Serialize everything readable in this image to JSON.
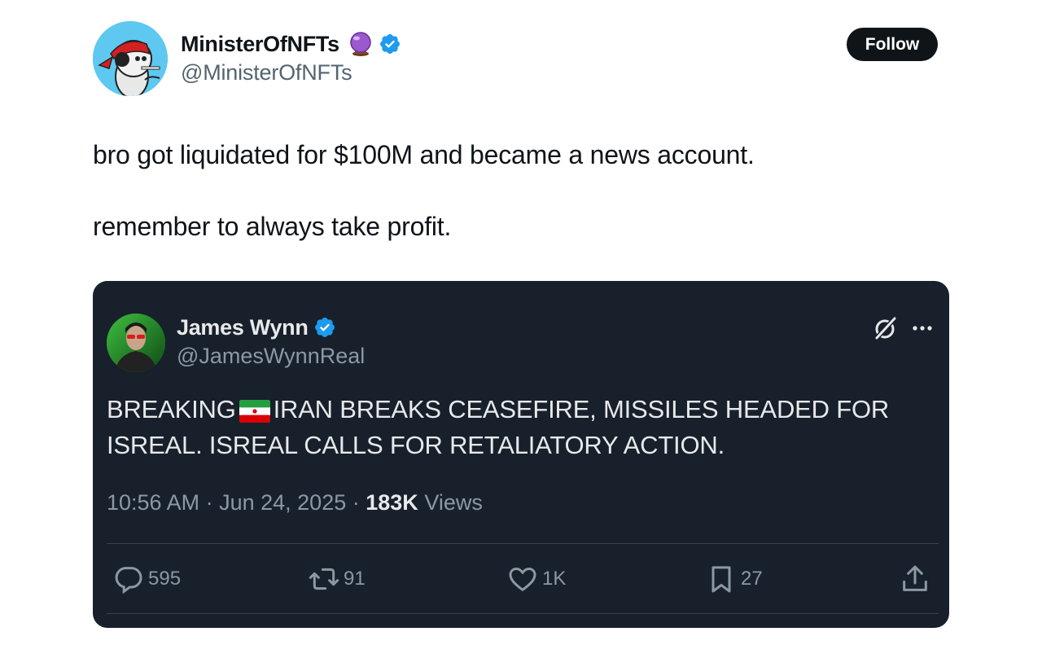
{
  "tweet": {
    "author_name": "MinisterOfNFTs",
    "author_handle": "@MinisterOfNFTs",
    "follow_label": "Follow",
    "text_line1": "bro got liquidated for $100M and became a news account.",
    "text_line2": "remember to always take profit."
  },
  "quoted": {
    "author_name": "James Wynn",
    "author_handle": "@JamesWynnReal",
    "text_part1": "BREAKING",
    "text_part2": "IRAN BREAKS CEASEFIRE, MISSILES HEADED FOR ISREAL. ISREAL CALLS FOR RETALIATORY ACTION.",
    "time": "10:56 AM",
    "date": "Jun 24, 2025",
    "views_count": "183K",
    "views_label": "Views",
    "replies": "595",
    "reposts": "91",
    "likes": "1K",
    "bookmarks": "27"
  },
  "icons": [
    "crystal-ball-icon",
    "verified-badge-icon",
    "grok-icon",
    "more-icon",
    "reply-icon",
    "repost-icon",
    "like-icon",
    "bookmark-icon",
    "share-icon",
    "iran-flag-icon"
  ],
  "colors": {
    "verified": "#1d9bf0",
    "follow_bg": "#0f1419",
    "card_bg": "#17202b",
    "muted": "#8b98a5"
  }
}
